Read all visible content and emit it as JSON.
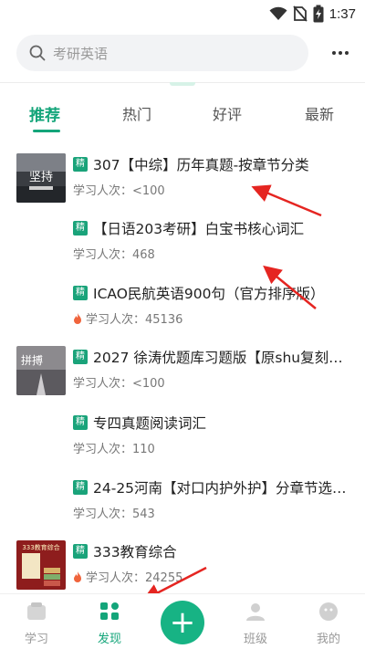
{
  "status_bar": {
    "time": "1:37",
    "icons": [
      "wifi-icon",
      "no-sim-icon",
      "battery-charging-icon"
    ]
  },
  "search": {
    "placeholder": "考研英语",
    "icon": "search-icon"
  },
  "more_menu": {
    "icon": "more-dots-icon"
  },
  "tabs": [
    {
      "label": "推荐",
      "active": true
    },
    {
      "label": "热门",
      "active": false
    },
    {
      "label": "好评",
      "active": false
    },
    {
      "label": "最新",
      "active": false
    }
  ],
  "courses": [
    {
      "badge": "精",
      "title": "307【中综】历年真题-按章节分类",
      "meta": "学习人次：<100",
      "hot": false,
      "thumb_text": "坚持"
    },
    {
      "badge": "精",
      "title": "【日语203考研】白宝书核心词汇",
      "meta": "学习人次：468",
      "hot": false
    },
    {
      "badge": "精",
      "title": "ICAO民航英语900句（官方排序版）",
      "meta": "学习人次：45136",
      "hot": true
    },
    {
      "badge": "精",
      "title": "2027 徐涛优题库习题版【原shu复刻…",
      "meta": "学习人次：<100",
      "hot": false,
      "thumb_text": "拼搏"
    },
    {
      "badge": "精",
      "title": "专四真题阅读词汇",
      "meta": "学习人次：110",
      "hot": false
    },
    {
      "badge": "精",
      "title": "24-25河南【对口内护外护】分章节选…",
      "meta": "学习人次：543",
      "hot": false
    },
    {
      "badge": "精",
      "title": "333教育综合",
      "meta": "学习人次：24255",
      "hot": true,
      "thumb_text": "333教育综合"
    }
  ],
  "bottom_nav": [
    {
      "label": "学习",
      "icon": "study-icon",
      "active": false
    },
    {
      "label": "发现",
      "icon": "discover-icon",
      "active": true
    },
    {
      "label": "",
      "icon": "add-icon",
      "active": false
    },
    {
      "label": "班级",
      "icon": "class-icon",
      "active": false
    },
    {
      "label": "我的",
      "icon": "profile-icon",
      "active": false
    }
  ],
  "colors": {
    "accent": "#14a57a",
    "badge": "#1aa37a",
    "hot": "#f0643c",
    "annotation_arrow": "#e52521"
  }
}
